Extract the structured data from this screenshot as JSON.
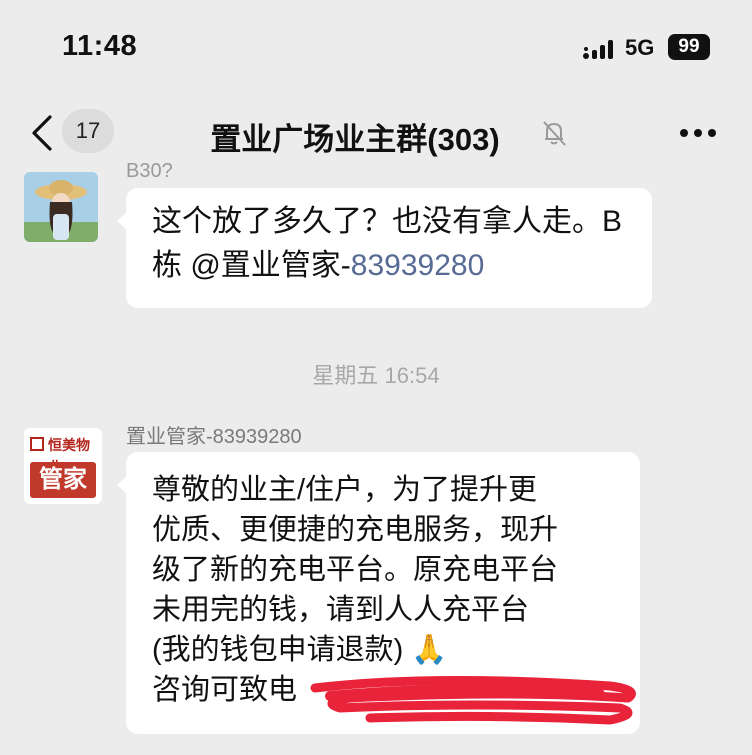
{
  "status_bar": {
    "time": "11:48",
    "network": "5G",
    "battery": "99"
  },
  "nav": {
    "unread_count": "17",
    "title": "置业广场业主群(303)"
  },
  "messages": [
    {
      "sender_partial": "B30?",
      "text": "这个放了多久了？也没有拿人走。B栋 @置业管家-",
      "mention_number": "83939280"
    },
    {
      "sender": "置业管家-83939280",
      "avatar_brand": "恒美物业",
      "avatar_tag": "管家",
      "text_lines": [
        "尊敬的业主/住户，为了提升更",
        "优质、更便捷的充电服务，现升",
        "级了新的充电平台。原充电平台",
        "未用完的钱，请到人人充平台",
        "(我的钱包申请退款) 🙏",
        "咨询可致电"
      ]
    }
  ],
  "timestamp": "星期五 16:54",
  "colors": {
    "background": "#ececec",
    "bubble": "#ffffff",
    "mention": "#576b95",
    "scribble": "#e8233a"
  }
}
